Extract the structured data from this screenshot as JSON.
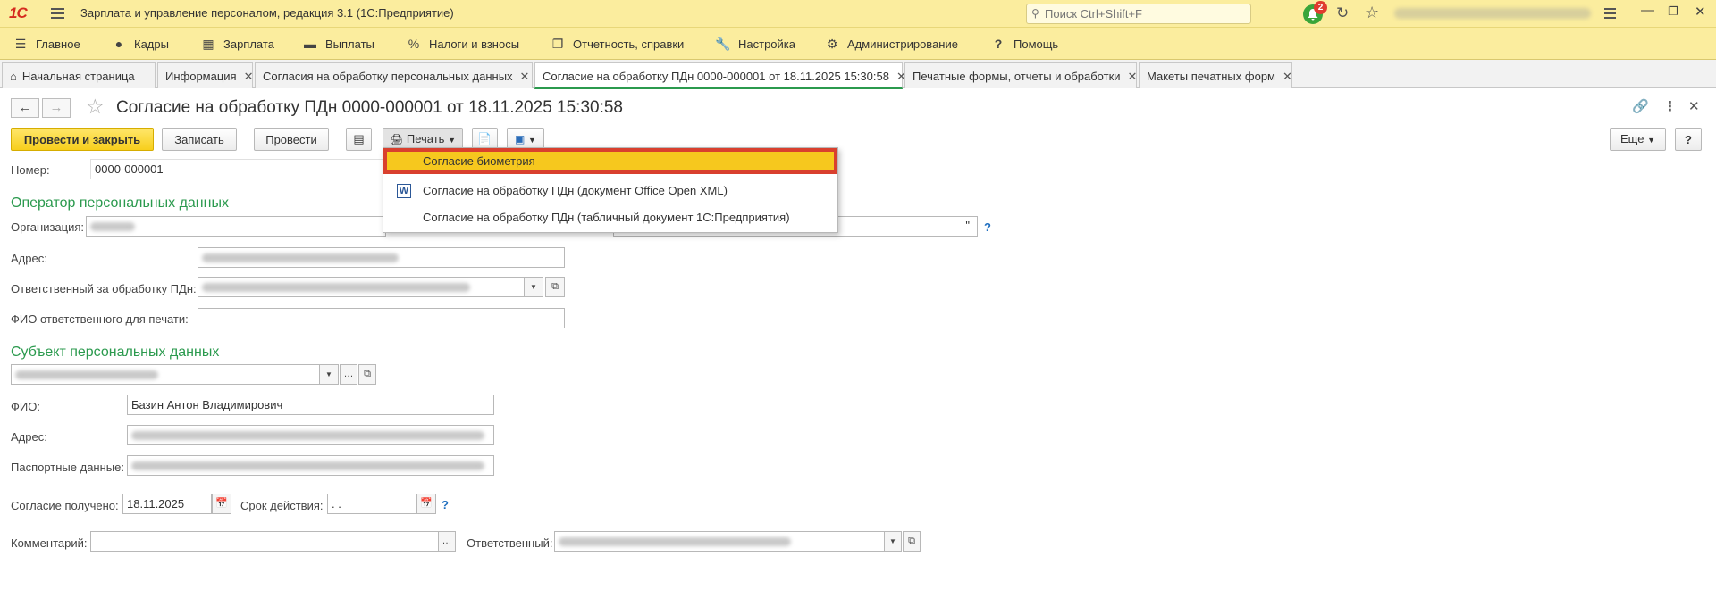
{
  "window": {
    "logo": "1С",
    "title": "Зарплата и управление персоналом, редакция 3.1  (1С:Предприятие)",
    "search_placeholder": "Поиск Ctrl+Shift+F",
    "notifications_count": "2"
  },
  "menu": [
    {
      "label": "Главное"
    },
    {
      "label": "Кадры"
    },
    {
      "label": "Зарплата"
    },
    {
      "label": "Выплаты"
    },
    {
      "label": "Налоги и взносы"
    },
    {
      "label": "Отчетность, справки"
    },
    {
      "label": "Настройка"
    },
    {
      "label": "Администрирование"
    },
    {
      "label": "Помощь"
    }
  ],
  "tabs": [
    {
      "label": "Начальная страница"
    },
    {
      "label": "Информация"
    },
    {
      "label": "Согласия на обработку персональных данных"
    },
    {
      "label": "Согласие на обработку ПДн 0000-000001 от 18.11.2025 15:30:58"
    },
    {
      "label": "Печатные формы, отчеты и обработки"
    },
    {
      "label": "Макеты печатных форм"
    }
  ],
  "document": {
    "title": "Согласие на обработку ПДн 0000-000001 от 18.11.2025 15:30:58"
  },
  "toolbar": {
    "post_close": "Провести и закрыть",
    "save": "Записать",
    "post": "Провести",
    "print": "Печать",
    "more": "Еще",
    "help": "?"
  },
  "print_menu": [
    {
      "label": "Согласие биометрия",
      "selected": true
    },
    {
      "label": "Согласие на обработку ПДн (документ Office Open XML)"
    },
    {
      "label": "Согласие на обработку ПДн (табличный документ 1С:Предприятия)"
    }
  ],
  "form": {
    "number_label": "Номер:",
    "number_value": "0000-000001",
    "operator_section": "Оператор персональных данных",
    "org_label": "Организация:",
    "address_label": "Адрес:",
    "responsible_label": "Ответственный за обработку ПДн:",
    "fio_print_label": "ФИО ответственного для печати:",
    "subject_section": "Субъект персональных данных",
    "fio_label": "ФИО:",
    "fio_value": "Базин Антон Владимирович",
    "subj_address_label": "Адрес:",
    "passport_label": "Паспортные данные:",
    "consent_label": "Согласие получено:",
    "consent_value": "18.11.2025",
    "validity_label": "Срок действия:",
    "validity_value": " .  .",
    "comment_label": "Комментарий:",
    "resp_label": "Ответственный:",
    "quote_char": "\"",
    "help_mark": "?"
  },
  "colors": {
    "accent": "#fbed9e",
    "primary_button": "#f7cf1c",
    "section": "#2b9a4e",
    "highlight_border": "#d9402e"
  }
}
